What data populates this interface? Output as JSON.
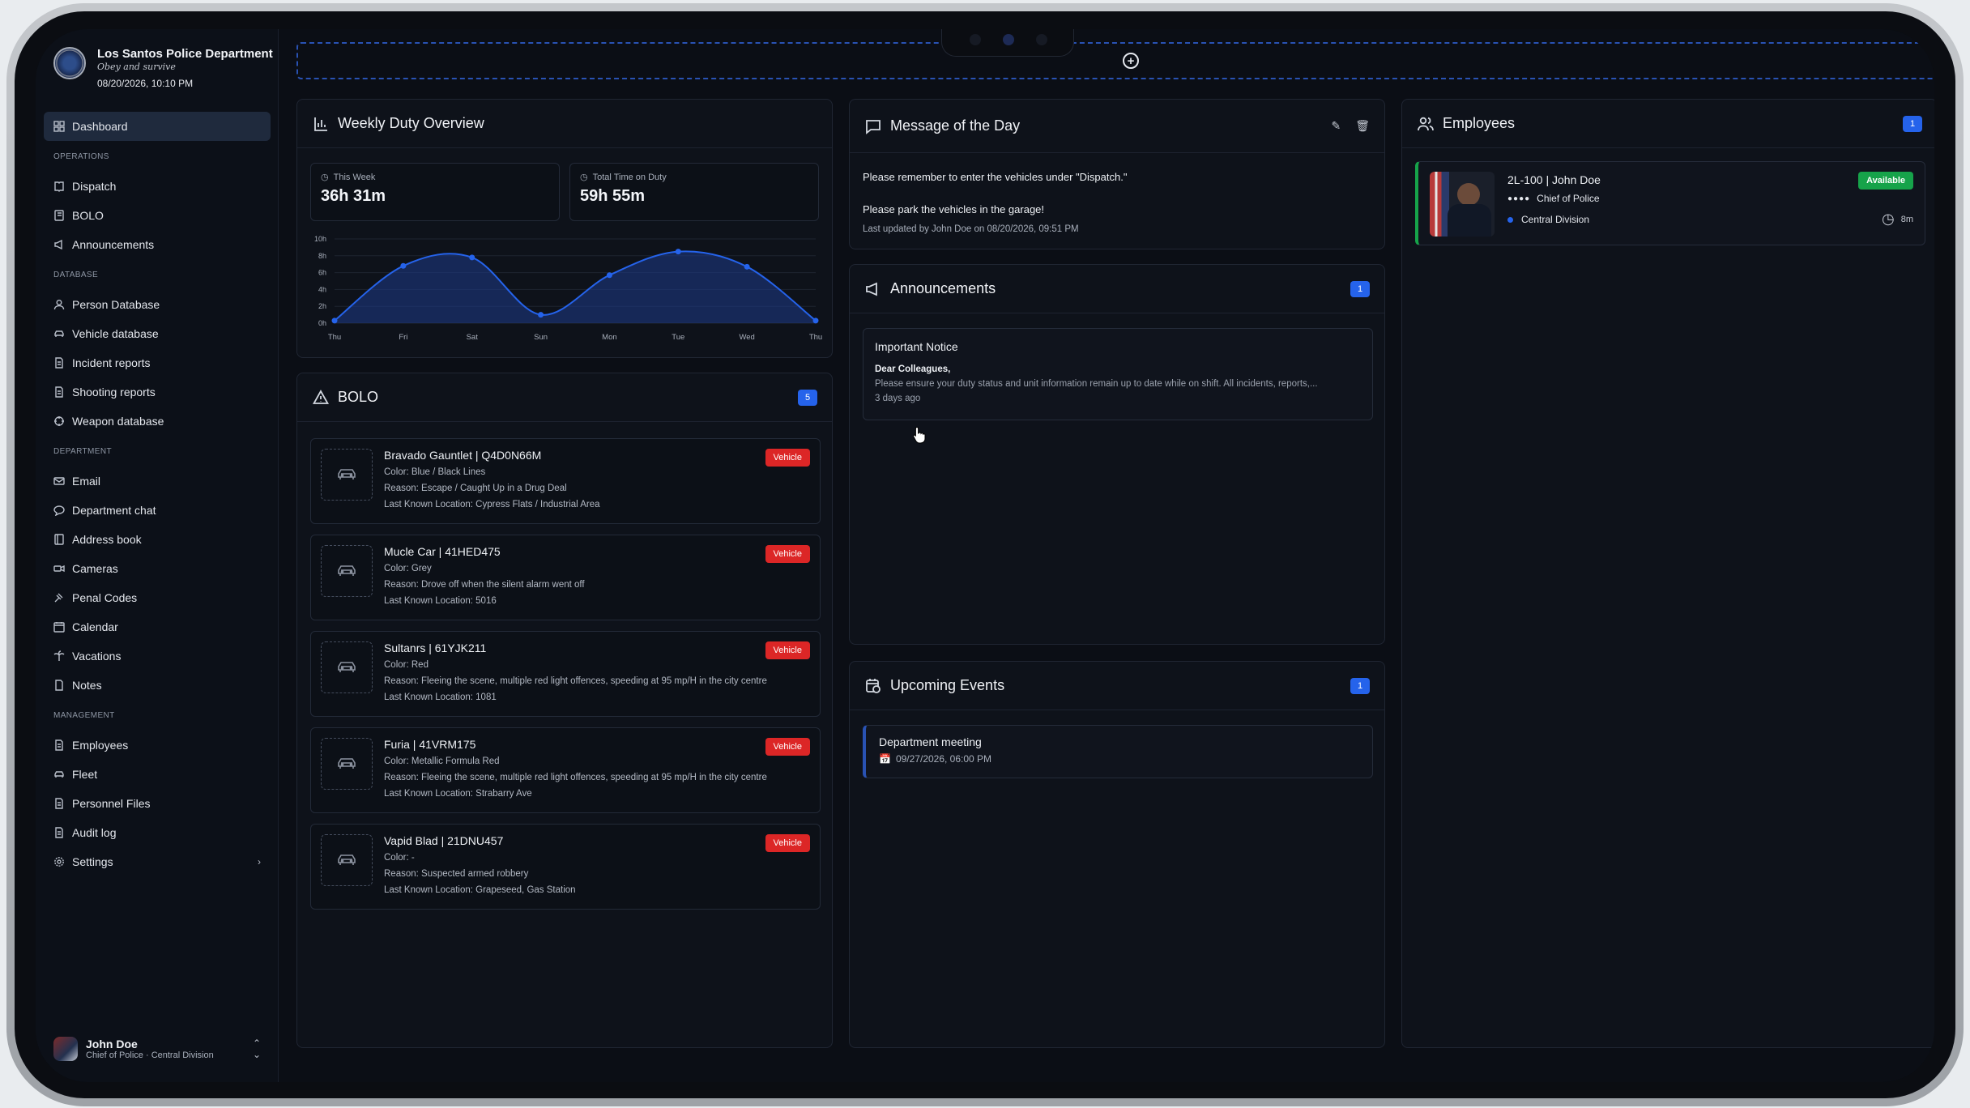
{
  "brand": {
    "title": "Los Santos Police Department",
    "motto": "Obey and survive",
    "datetime": "08/20/2026, 10:10 PM"
  },
  "nav": {
    "dashboard": "Dashboard",
    "operations_label": "OPERATIONS",
    "operations": [
      "Dispatch",
      "BOLO",
      "Announcements"
    ],
    "database_label": "DATABASE",
    "database": [
      "Person Database",
      "Vehicle database",
      "Incident reports",
      "Shooting reports",
      "Weapon database"
    ],
    "department_label": "DEPARTMENT",
    "department": [
      "Email",
      "Department chat",
      "Address book",
      "Cameras",
      "Penal Codes",
      "Calendar",
      "Vacations",
      "Notes"
    ],
    "management_label": "MANAGEMENT",
    "management": [
      "Employees",
      "Fleet",
      "Personnel Files",
      "Audit log",
      "Settings"
    ]
  },
  "user": {
    "name": "John Doe",
    "role": "Chief of Police · Central Division"
  },
  "duty": {
    "title": "Weekly Duty Overview",
    "this_week_label": "This Week",
    "this_week": "36h 31m",
    "total_label": "Total Time on Duty",
    "total": "59h 55m"
  },
  "chart_data": {
    "type": "area",
    "categories": [
      "Thu",
      "Fri",
      "Sat",
      "Sun",
      "Mon",
      "Tue",
      "Wed",
      "Thu"
    ],
    "values": [
      0.3,
      6.8,
      7.8,
      1,
      5.7,
      8.5,
      6.7,
      0.3
    ],
    "y_ticks": [
      "10h",
      "8h",
      "6h",
      "4h",
      "2h",
      "0h"
    ],
    "ylim": [
      0,
      10
    ],
    "grid": true,
    "color": "#2563eb"
  },
  "bolo": {
    "title": "BOLO",
    "count": "5",
    "items": [
      {
        "title": "Bravado Gauntlet | Q4D0N66M",
        "tag": "Vehicle",
        "color": "Color: Blue / Black Lines",
        "reason": "Reason: Escape / Caught Up in a Drug Deal",
        "location": "Last Known Location: Cypress Flats / Industrial Area"
      },
      {
        "title": "Mucle Car | 41HED475",
        "tag": "Vehicle",
        "color": "Color: Grey",
        "reason": "Reason: Drove off when the silent alarm went off",
        "location": "Last Known Location: 5016"
      },
      {
        "title": "Sultanrs | 61YJK211",
        "tag": "Vehicle",
        "color": "Color: Red",
        "reason": "Reason: Fleeing the scene, multiple red light offences, speeding at 95 mp/H in the city centre",
        "location": "Last Known Location: 1081"
      },
      {
        "title": "Furia | 41VRM175",
        "tag": "Vehicle",
        "color": "Color: Metallic Formula Red",
        "reason": "Reason: Fleeing the scene, multiple red light offences, speeding at 95 mp/H in the city centre",
        "location": "Last Known Location: Strabarry Ave"
      },
      {
        "title": "Vapid Blad | 21DNU457",
        "tag": "Vehicle",
        "color": "Color: -",
        "reason": "Reason: Suspected armed robbery",
        "location": "Last Known Location: Grapeseed, Gas Station"
      }
    ]
  },
  "motd": {
    "title": "Message of the Day",
    "line1": "Please remember to enter the vehicles under \"Dispatch.\"",
    "line2": "Please park the vehicles in the garage!",
    "updated": "Last updated by John Doe on 08/20/2026, 09:51 PM"
  },
  "announcements": {
    "title": "Announcements",
    "count": "1",
    "item": {
      "title": "Important Notice",
      "greeting": "Dear Colleagues,",
      "body": "Please ensure your duty status and unit information remain up to date while on shift. All incidents, reports,...",
      "age": "3 days ago"
    }
  },
  "events": {
    "title": "Upcoming Events",
    "count": "1",
    "item": {
      "title": "Department meeting",
      "date": "09/27/2026, 06:00 PM"
    }
  },
  "employees": {
    "title": "Employees",
    "count": "1",
    "item": {
      "name": "2L-100 | John Doe",
      "status": "Available",
      "rank": "Chief of Police",
      "division": "Central Division",
      "time": "8m"
    }
  }
}
